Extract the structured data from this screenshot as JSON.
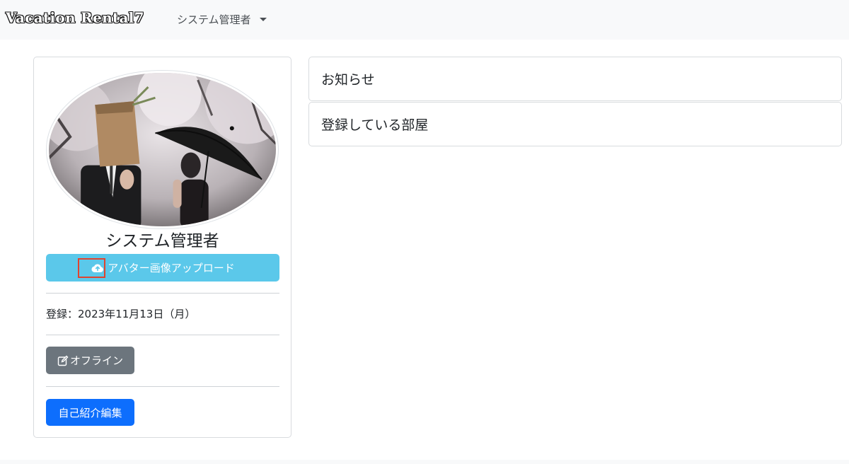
{
  "navbar": {
    "brand": "Vacation Rental7",
    "user_menu_label": "システム管理者"
  },
  "profile": {
    "avatar_icon": "avatar-photo",
    "name": "システム管理者",
    "upload_button_label": "アバター画像アップロード",
    "upload_icon": "cloud-upload-icon",
    "registration_label": "登録：2023年11月13日（月）",
    "status_button_label": "オフライン",
    "status_icon": "edit-icon",
    "edit_intro_button_label": "自己紹介編集"
  },
  "panels": {
    "notice_title": "お知らせ",
    "rooms_title": "登録している部屋"
  },
  "colors": {
    "info": "#5bc8ea",
    "secondary": "#6c757d",
    "primary": "#0d6efd",
    "highlight": "#e0432f"
  }
}
